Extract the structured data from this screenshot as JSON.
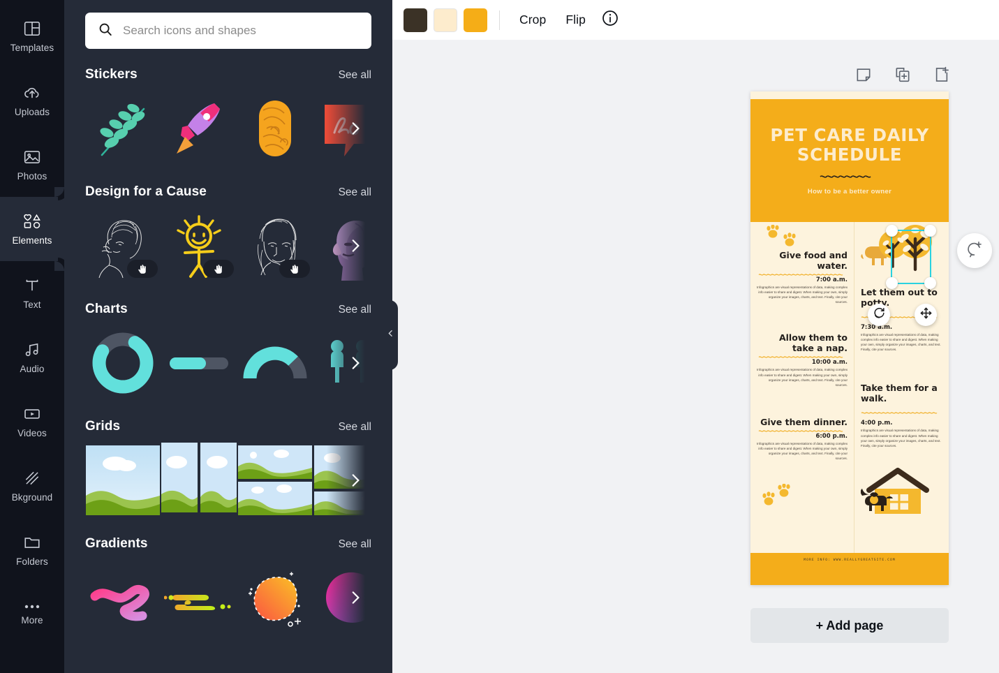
{
  "rail": {
    "items": [
      {
        "label": "Templates",
        "icon": "templates-icon",
        "active": false
      },
      {
        "label": "Uploads",
        "icon": "upload-cloud-icon",
        "active": false
      },
      {
        "label": "Photos",
        "icon": "photo-icon",
        "active": false
      },
      {
        "label": "Elements",
        "icon": "elements-shapes-icon",
        "active": true
      },
      {
        "label": "Text",
        "icon": "text-icon",
        "active": false
      },
      {
        "label": "Audio",
        "icon": "music-note-icon",
        "active": false
      },
      {
        "label": "Videos",
        "icon": "video-icon",
        "active": false
      },
      {
        "label": "Bkground",
        "icon": "background-hatch-icon",
        "active": false
      },
      {
        "label": "Folders",
        "icon": "folder-icon",
        "active": false
      },
      {
        "label": "More",
        "icon": "ellipsis-icon",
        "active": false
      }
    ]
  },
  "search": {
    "placeholder": "Search icons and shapes",
    "value": "",
    "icon": "search-icon"
  },
  "panel": {
    "see_all_label": "See all",
    "sections": [
      {
        "title": "Stickers",
        "items": [
          "leaf-branch-sticker",
          "rocket-sticker",
          "wood-texture-sticker",
          "love-speech-bubble-sticker"
        ]
      },
      {
        "title": "Design for a Cause",
        "items": [
          "line-art-woman-profile",
          "yellow-stick-figure",
          "line-art-woman-face",
          "purple-woman-profile"
        ]
      },
      {
        "title": "Charts",
        "items": [
          "donut-chart",
          "progress-bar-chart",
          "gauge-chart",
          "pictogram-people-chart"
        ]
      },
      {
        "title": "Grids",
        "items": [
          "grid-single",
          "grid-two-columns",
          "grid-two-rows",
          "grid-mixed"
        ]
      },
      {
        "title": "Gradients",
        "items": [
          "pink-brush-stroke",
          "lime-liquid-blob",
          "orange-dashed-blob",
          "magenta-purple-blob"
        ]
      }
    ],
    "collapse_icon": "chevron-left-icon",
    "next_icon": "chevron-right-icon",
    "drag_icon": "hand-drag-icon"
  },
  "toolbar": {
    "swatches": [
      "#3b3226",
      "#fdeccd",
      "#f5ad17"
    ],
    "crop_label": "Crop",
    "flip_label": "Flip",
    "info_icon": "info-circle-icon"
  },
  "canvas": {
    "page_tools": [
      {
        "icon": "notes-icon"
      },
      {
        "icon": "duplicate-page-icon"
      },
      {
        "icon": "add-page-icon"
      }
    ],
    "add_page_label": "+ Add page",
    "help_icon": "comment-add-icon",
    "selection": {
      "rotate_icon": "rotate-icon",
      "move_icon": "move-arrows-icon",
      "handles": 4
    }
  },
  "document": {
    "title": "PET CARE DAILY SCHEDULE",
    "subtitle": "How to be a better owner",
    "body_text": "Infographics are visual representations of data, making complex info easier to share and digest. When making your own, simply organize your images, charts, and text. Finally, cite your sources.",
    "footer": "MORE INFO: WWW.REALLYGREATSITE.COM",
    "colors": {
      "banner": "#f4ad1a",
      "paper": "#fdf3dd",
      "cream": "#fdeccd",
      "ink": "#231f1c"
    },
    "left_items": [
      {
        "heading": "Give food and water.",
        "time": "7:00 a.m."
      },
      {
        "heading": "Allow them to take a nap.",
        "time": "10:00 a.m."
      },
      {
        "heading": "Give them dinner.",
        "time": "6:00 p.m."
      }
    ],
    "right_items": [
      {
        "heading": "Let them out to potty.",
        "time": "7:30 a.m."
      },
      {
        "heading": "Take them for a walk.",
        "time": "4:00 p.m."
      }
    ]
  }
}
